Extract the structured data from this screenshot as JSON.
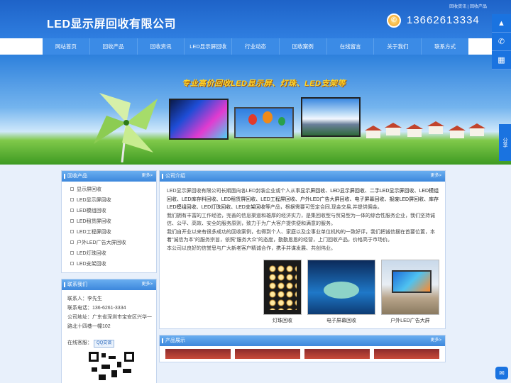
{
  "header": {
    "top_links": [
      "回收资讯",
      "回收产品"
    ],
    "top_links_sep": "|",
    "company_name": "LED显示屏回收有限公司",
    "phone": "13662613334",
    "phone_icon": "phone-icon"
  },
  "nav": {
    "items": [
      "网站首页",
      "回收产品",
      "回收资讯",
      "LED显示屏回收",
      "行业动态",
      "回收案例",
      "在线留言",
      "关于我们",
      "联系方式"
    ]
  },
  "banner": {
    "slogan": "专业高价回收LED显示屏、灯珠、LED支架等"
  },
  "sidebar": {
    "products": {
      "title": "回收产品",
      "more": "更多>",
      "items": [
        "显示屏回收",
        "LED显示屏回收",
        "LED模组回收",
        "LED租赁屏回收",
        "LED工程屏回收",
        "户外LED广告大屏回收",
        "LED灯珠回收",
        "LED支架回收"
      ]
    },
    "contact": {
      "title": "联系我们",
      "more": "更多>",
      "person": "联系人：李先生",
      "phone": "联系电话：136-6261-3334",
      "address": "公司地址：广东省深圳市宝安区兴华一路北十四巷一幢102",
      "online_label": "在线客服：",
      "qq_label": "QQ交谈"
    }
  },
  "content": {
    "intro": {
      "title": "公司介绍",
      "more": "更多>",
      "p1_lead": "LED显示屏回收有限公司长期面向各LED封装企业或个人从事",
      "p1_keywords": "显示屏回收、LED显示屏回收、二手LED显示屏回收、LED模组回收、LED库存料回收、LED租赁屏回收、LED工程屏回收、户外LED广告大屏回收、电子屏幕回收、报废LED屏回收、库存LED模组回收、LED灯珠回收、LED支架回收",
      "p1_tail": "等产品，根据需要可签定合同,现金交易,并提供佣金。",
      "p2": "我们拥有丰富的工作经验，完善的信息渠道和雄厚的经济实力，是集回收型与贸易型为一体的综合性服务企业，我们坚持诚信、公平、高效、安全的服务原则，致力于为广大客户提供便和满意的服务。",
      "p3": "我们自开业以来有很多成功的回收案例，也得到个人、家庭以及企事业单位机构的一致好评，我们把诚信摆在首要位置，本着\"诚信为本\"的服务宗旨，依照\"服务大众\"的态度，勤勤恳恳的经营，上门回收产品，价格高于市场价。",
      "p4": "本公司以良好的信誉思与广大新老客户精诚合作，携手并谋发展、共创伟业。"
    },
    "gallery": [
      {
        "caption": "灯珠回收"
      },
      {
        "caption": "电子屏幕回收"
      },
      {
        "caption": "户外LED广告大屏"
      }
    ],
    "products_box": {
      "title": "产品展示",
      "more": "更多>"
    }
  },
  "float_bar": {
    "buttons": [
      "up-arrow-icon",
      "phone-icon",
      "qrcode-icon"
    ],
    "share": "分享",
    "chat_icon": "chat-icon"
  }
}
